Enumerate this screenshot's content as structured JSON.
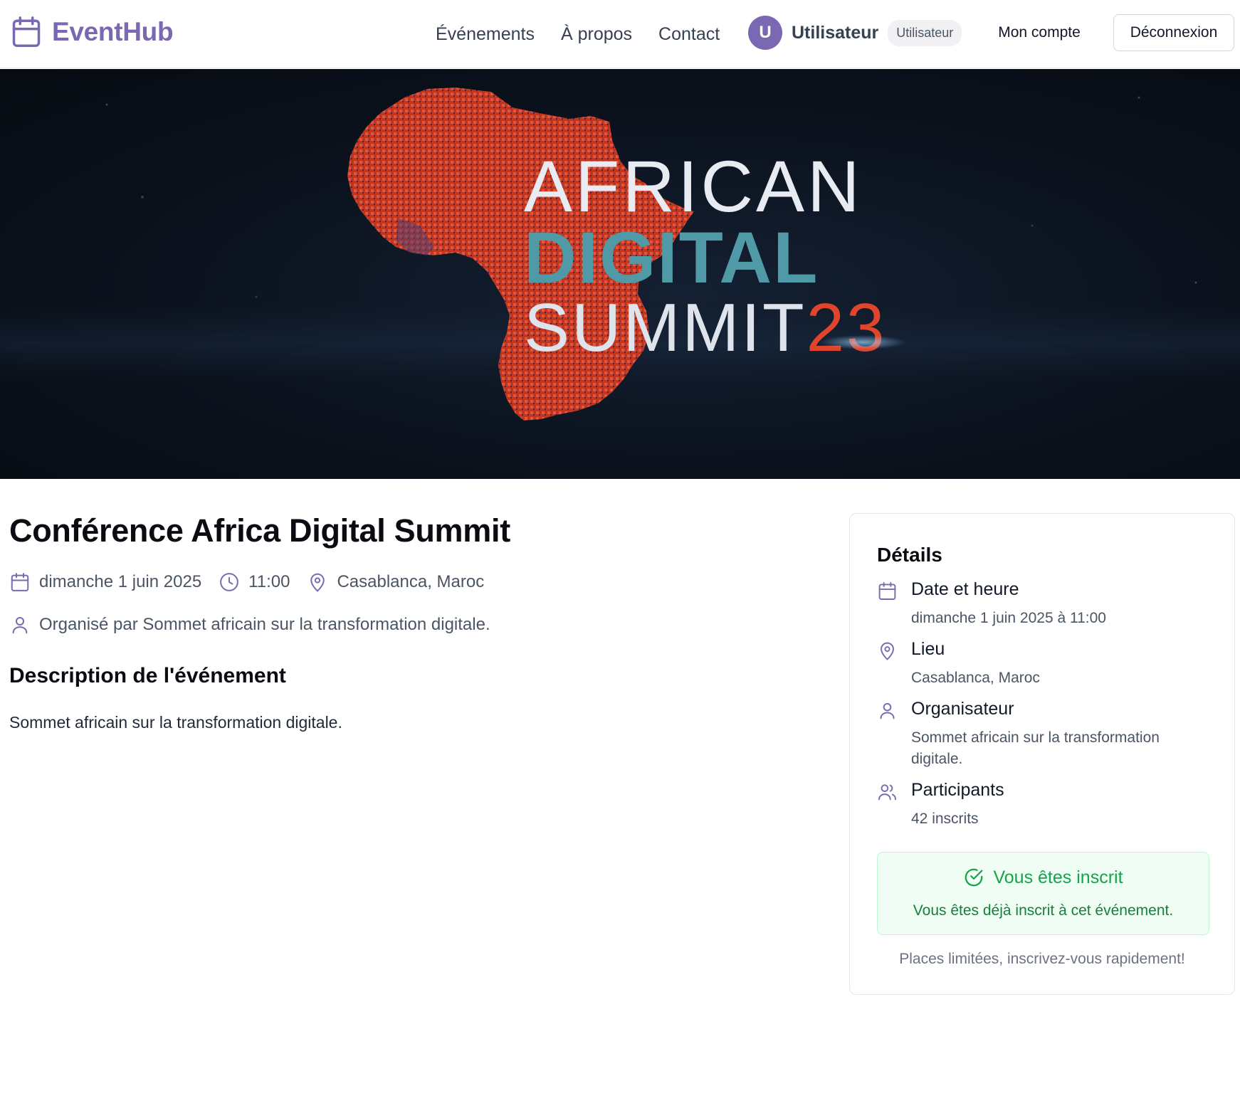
{
  "header": {
    "brand": "EventHub",
    "nav": [
      "Événements",
      "À propos",
      "Contact"
    ],
    "user": {
      "initial": "U",
      "name": "Utilisateur",
      "role": "Utilisateur"
    },
    "account_label": "Mon compte",
    "logout_label": "Déconnexion"
  },
  "hero": {
    "line1": "AFRICAN",
    "line2": "DIGITAL",
    "line3": "SUMMIT",
    "year": "23"
  },
  "event": {
    "title": "Conférence Africa Digital Summit",
    "date": "dimanche 1 juin 2025",
    "time": "11:00",
    "location": "Casablanca, Maroc",
    "organizer_line": "Organisé par Sommet africain sur la transformation digitale.",
    "description_heading": "Description de l'événement",
    "description": "Sommet africain sur la transformation digitale."
  },
  "details": {
    "title": "Détails",
    "date_label": "Date et heure",
    "date_value": "dimanche 1 juin 2025 à 11:00",
    "place_label": "Lieu",
    "place_value": "Casablanca, Maroc",
    "organizer_label": "Organisateur",
    "organizer_value": "Sommet africain sur la transformation digitale.",
    "participants_label": "Participants",
    "participants_value": "42 inscrits",
    "registered_title": "Vous êtes inscrit",
    "registered_sub": "Vous êtes déjà inscrit à cet événement.",
    "limited_note": "Places limitées, inscrivez-vous rapidement!"
  },
  "colors": {
    "brand": "#7b68b3",
    "success": "#16a34a",
    "hero_red": "#e0452b",
    "hero_teal": "#4f9aa6"
  }
}
